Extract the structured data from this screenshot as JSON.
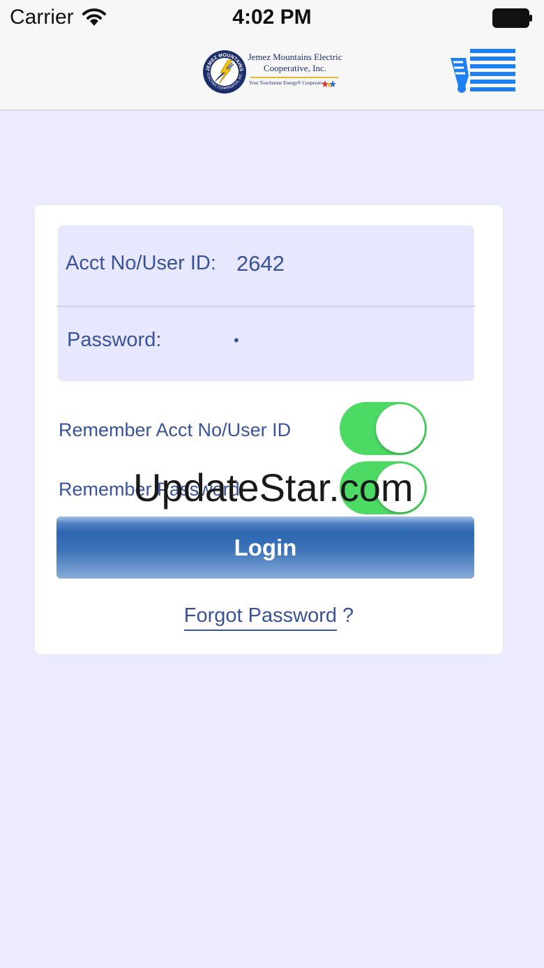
{
  "status_bar": {
    "carrier": "Carrier",
    "time": "4:02 PM"
  },
  "nav_bar": {
    "logo": {
      "name_line1": "Jemez Mountains Electric",
      "name_line2": "Cooperative, Inc.",
      "tagline": "Your Touchstone Energy® Cooperative",
      "seal_top": "JEMEZ MOUNTAINS",
      "seal_bottom": "ELECTRIC COOPERATIVE, INC."
    },
    "menu_icon": "menu-icon"
  },
  "login_form": {
    "account_label": "Acct No/User ID:",
    "account_value": "2642",
    "password_label": "Password:",
    "password_value": "•",
    "remember_account_label": "Remember Acct No/User ID",
    "remember_account_on": true,
    "remember_password_label": "Remember Password",
    "remember_password_on": true,
    "login_label": "Login",
    "forgot_label": "Forgot Password",
    "forgot_suffix": " ?"
  },
  "colors": {
    "page_background": "#ebebfd",
    "field_background": "#e7e7fd",
    "text_blue": "#39539a",
    "toggle_green": "#4cd964",
    "menu_icon_blue": "#1d7ff0"
  },
  "watermark": "UpdateStar.com"
}
